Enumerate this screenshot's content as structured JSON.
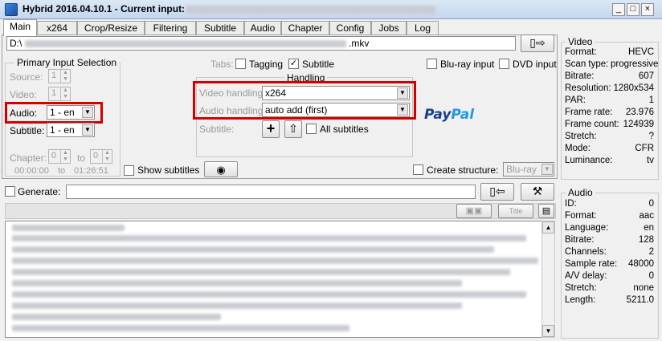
{
  "window": {
    "title": "Hybrid 2016.04.10.1 - Current input:",
    "controls": [
      "_",
      "□",
      "×"
    ]
  },
  "tabs": [
    "Main",
    "x264",
    "Crop/Resize",
    "Filtering",
    "Subtitle",
    "Audio",
    "Chapter",
    "Config",
    "Jobs",
    "Log"
  ],
  "main": {
    "input_path_prefix": "D:\\",
    "input_path_suffix": ".mkv",
    "primary_input": {
      "title": "Primary Input Selection",
      "source_label": "Source:",
      "source_value": "1",
      "video_label": "Video:",
      "video_value": "1",
      "audio_label": "Audio:",
      "audio_value": "1 - en",
      "subtitle_label": "Subtitle:",
      "subtitle_value": "1 - en",
      "chapter_label": "Chapter:",
      "chapter_from": "0",
      "chapter_to_label": "to",
      "chapter_to": "0",
      "time_from": "00:00:00",
      "time_to_label": "to",
      "time_to": "01:26:51"
    },
    "show_subtitles_label": "Show subtitles",
    "tabs_label": "Tabs:",
    "tagging_label": "Tagging",
    "subtitle_tab_label": "Subtitle",
    "bluray_input_label": "Blu-ray input",
    "dvd_input_label": "DVD input",
    "handling": {
      "title": "Handling",
      "video_label": "Video handling:",
      "video_value": "x264",
      "audio_label": "Audio handling:",
      "audio_value": "auto add (first)",
      "subtitle_label": "Subtitle:",
      "all_subtitles_label": "All subtitles"
    },
    "paypal": "PayPal",
    "create_structure_label": "Create structure:",
    "create_structure_value": "Blu-ray",
    "generate_label": "Generate:"
  },
  "video_info": {
    "title": "Video",
    "rows": [
      {
        "k": "Format:",
        "v": "HEVC"
      },
      {
        "k": "Scan type:",
        "v": "progressive"
      },
      {
        "k": "Bitrate:",
        "v": "607"
      },
      {
        "k": "Resolution:",
        "v": "1280x534"
      },
      {
        "k": "PAR:",
        "v": "1"
      },
      {
        "k": "Frame rate:",
        "v": "23.976"
      },
      {
        "k": "Frame count:",
        "v": "124939"
      },
      {
        "k": "Stretch:",
        "v": "?"
      },
      {
        "k": "Mode:",
        "v": "CFR"
      },
      {
        "k": "Luminance:",
        "v": "tv"
      }
    ]
  },
  "audio_info": {
    "title": "Audio",
    "rows": [
      {
        "k": "ID:",
        "v": "0"
      },
      {
        "k": "Format:",
        "v": "aac"
      },
      {
        "k": "Language:",
        "v": "en"
      },
      {
        "k": "Bitrate:",
        "v": "128"
      },
      {
        "k": "Channels:",
        "v": "2"
      },
      {
        "k": "Sample rate:",
        "v": "48000"
      },
      {
        "k": "A/V delay:",
        "v": "0"
      },
      {
        "k": "Stretch:",
        "v": "none"
      },
      {
        "k": "Length:",
        "v": "5211.0"
      }
    ]
  },
  "toolbar": {
    "title_button": "Title"
  },
  "colors": {
    "highlight": "#d40000",
    "paypal_dark": "#1a3d8f",
    "paypal_light": "#1e9be0"
  }
}
